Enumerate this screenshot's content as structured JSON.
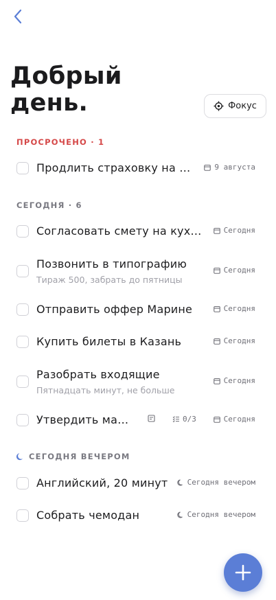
{
  "header": {
    "back_icon": "chevron-left-icon",
    "greeting_line1": "Добрый",
    "greeting_line2": "день.",
    "focus_label": "Фокус",
    "focus_icon": "target-icon"
  },
  "colors": {
    "accent": "#5b7ed6",
    "overdue": "#d54848",
    "muted": "#7a7a82"
  },
  "sections": {
    "overdue": {
      "label": "ПРОСРОЧЕНО · 1"
    },
    "today": {
      "label": "СЕГОДНЯ · 6"
    },
    "evening": {
      "label": "СЕГОДНЯ ВЕЧЕРОМ",
      "icon": "moon-icon"
    }
  },
  "tasks": {
    "overdue": [
      {
        "title": "Продлить страховку на машину",
        "due": "9 августа"
      }
    ],
    "today": [
      {
        "title": "Согласовать смету на кухню",
        "due": "Сегодня"
      },
      {
        "title": "Позвонить в типографию",
        "note": "Тираж 500, забрать до пятницы",
        "due": "Сегодня"
      },
      {
        "title": "Отправить оффер Марине",
        "due": "Сегодня"
      },
      {
        "title": "Купить билеты в Казань",
        "due": "Сегодня"
      },
      {
        "title": "Разобрать входящие",
        "note": "Пятнадцать минут, не больше",
        "due": "Сегодня"
      },
      {
        "title": "Утвердить макет",
        "checklist": "0/3",
        "due": "Сегодня"
      }
    ],
    "evening": [
      {
        "title": "Английский, 20 минут",
        "due": "Сегодня вечером"
      },
      {
        "title": "Собрать чемодан",
        "due": "Сегодня вечером"
      }
    ]
  },
  "fab": {
    "icon": "plus-icon"
  }
}
